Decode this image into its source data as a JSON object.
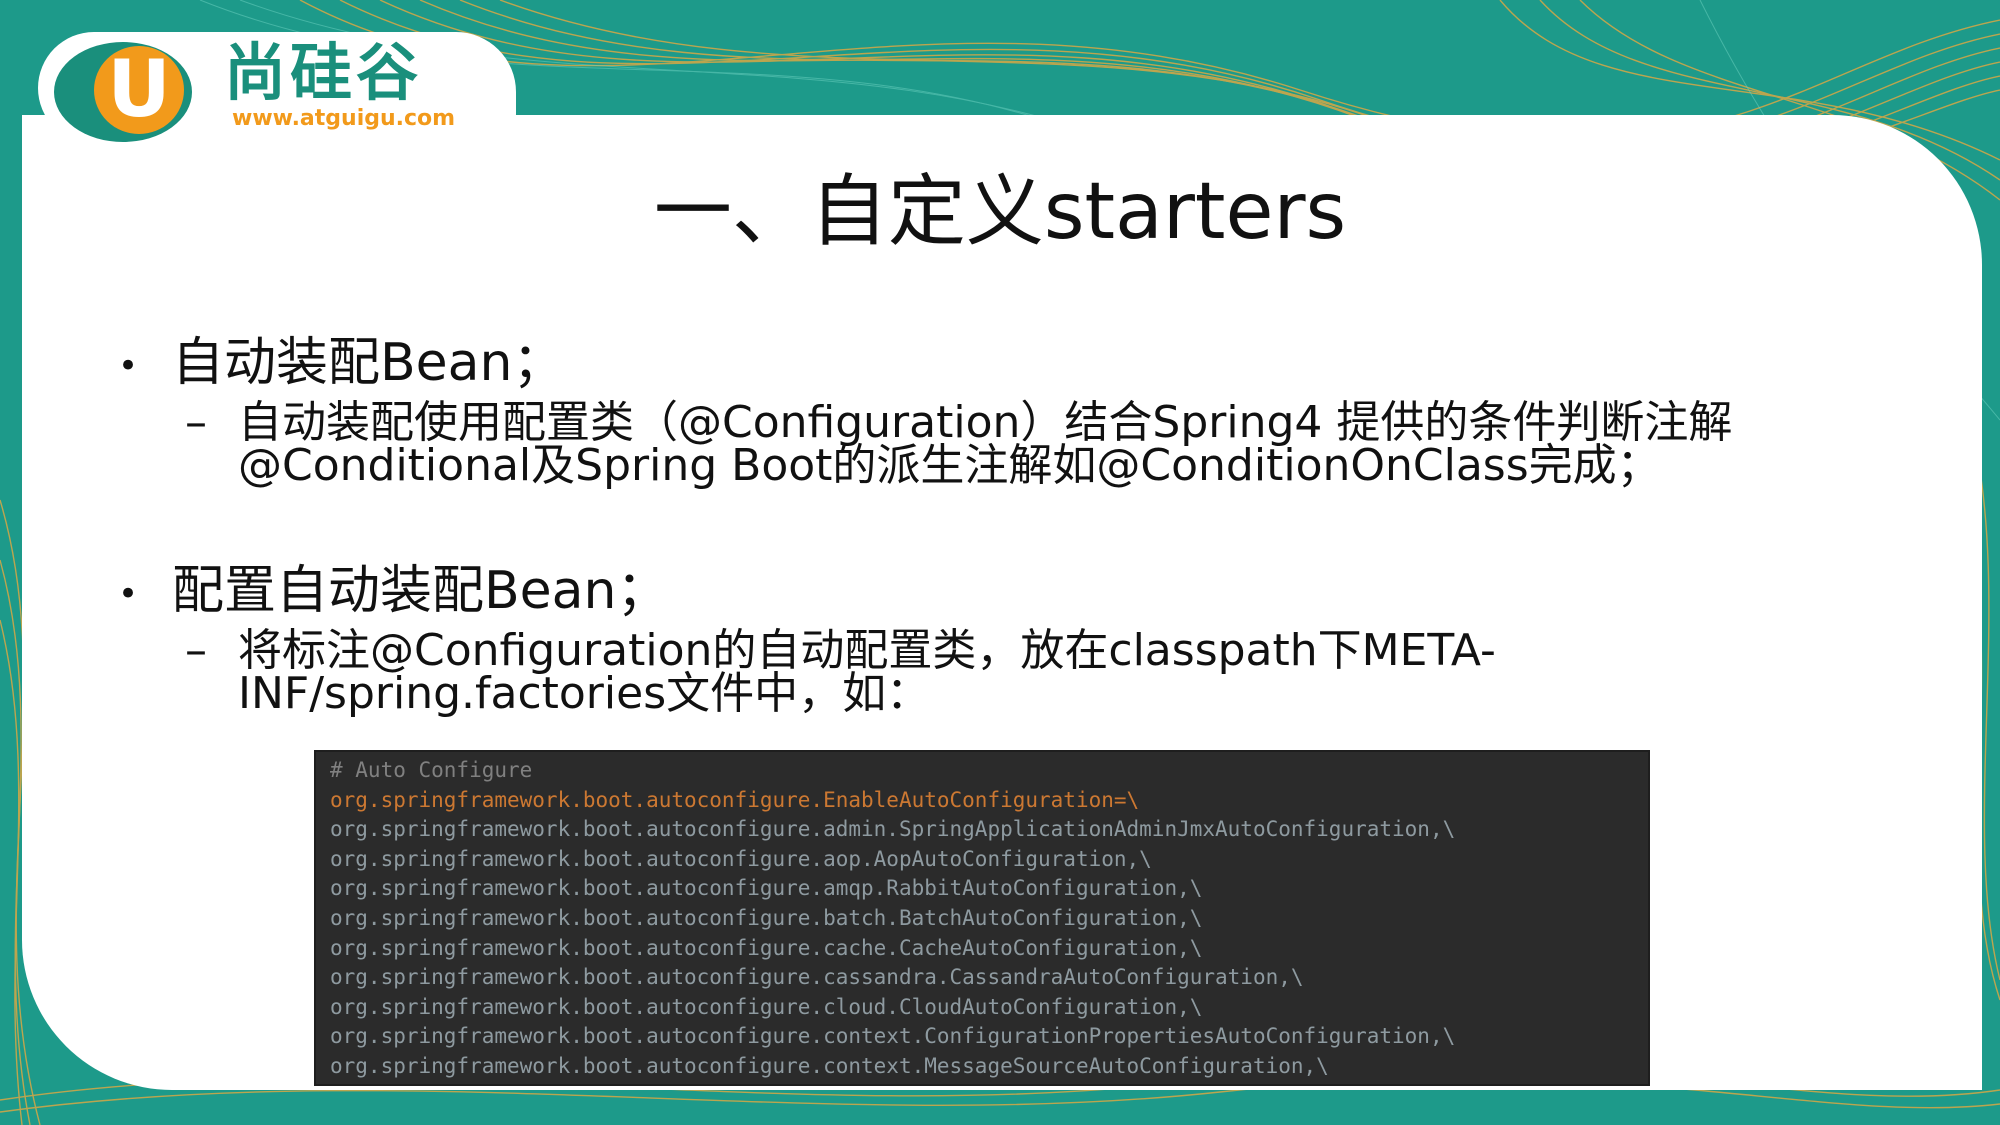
{
  "logo": {
    "letter": "U",
    "name": "尚硅谷",
    "url": "www.atguigu.com"
  },
  "title": "一、自定义starters",
  "sections": [
    {
      "bullet": "自动装配Bean；",
      "sub_lines": [
        "自动装配使用配置类（@Configuration）结合Spring4 提供的条件判断注解",
        "@Conditional及Spring Boot的派生注解如@ConditionOnClass完成；"
      ]
    },
    {
      "bullet": "配置自动装配Bean；",
      "sub_lines": [
        "将标注@Configuration的自动配置类，放在classpath下META-",
        "INF/spring.factories文件中，如："
      ]
    }
  ],
  "bullet_symbol": "•",
  "dash_symbol": "–",
  "code": {
    "comment": "# Auto Configure",
    "key_line": "org.springframework.boot.autoconfigure.EnableAutoConfiguration=\\",
    "lines": [
      "org.springframework.boot.autoconfigure.admin.SpringApplicationAdminJmxAutoConfiguration,\\",
      "org.springframework.boot.autoconfigure.aop.AopAutoConfiguration,\\",
      "org.springframework.boot.autoconfigure.amqp.RabbitAutoConfiguration,\\",
      "org.springframework.boot.autoconfigure.batch.BatchAutoConfiguration,\\",
      "org.springframework.boot.autoconfigure.cache.CacheAutoConfiguration,\\",
      "org.springframework.boot.autoconfigure.cassandra.CassandraAutoConfiguration,\\",
      "org.springframework.boot.autoconfigure.cloud.CloudAutoConfiguration,\\",
      "org.springframework.boot.autoconfigure.context.ConfigurationPropertiesAutoConfiguration,\\",
      "org.springframework.boot.autoconfigure.context.MessageSourceAutoConfiguration,\\"
    ]
  },
  "colors": {
    "background_teal": "#1d9a8a",
    "accent_orange": "#f29a1b",
    "brand_green": "#1a8f7c",
    "code_bg": "#2b2b2b",
    "code_key": "#cc7832"
  }
}
